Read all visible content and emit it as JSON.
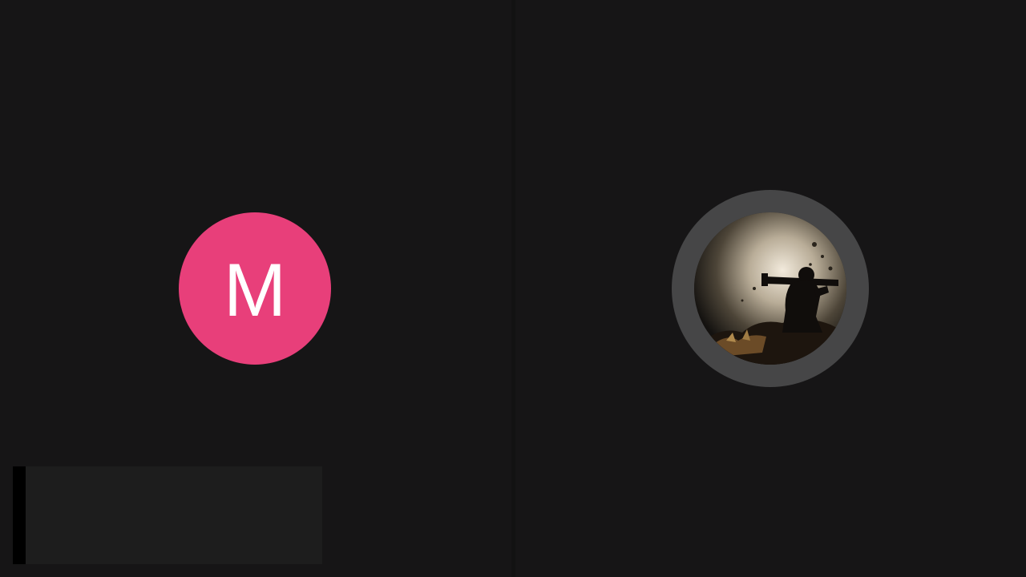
{
  "call": {
    "participant_one": {
      "initial": "M",
      "avatar_color": "#e83f7a"
    },
    "participant_two": {
      "avatar_icon": "soldier-silhouette-photo",
      "ring_color": "#464647"
    },
    "self_view": {
      "accent_color": "#000000"
    }
  },
  "colors": {
    "background": "#161516"
  }
}
